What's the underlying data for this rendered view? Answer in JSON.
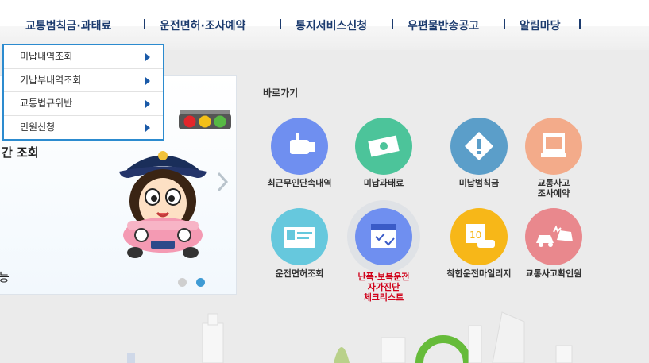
{
  "nav": {
    "items": [
      "교통범칙금·과태료",
      "운전면허·조사예약",
      "통지서비스신청",
      "우편물반송공고",
      "알림마당"
    ]
  },
  "submenu": {
    "items": [
      "미납내역조회",
      "기납부내역조회",
      "교통법규위반",
      "민원신청"
    ]
  },
  "banner": {
    "partial_text": "간 조회",
    "partial_bottom": "능"
  },
  "quick": {
    "title": "바로가기",
    "items": [
      {
        "label": "최근무인단속내역",
        "icon": "camera-icon",
        "color": "#6f8ff0"
      },
      {
        "label": "미납과태료",
        "icon": "money-icon",
        "color": "#4cc49a"
      },
      {
        "label": "미납범칙금",
        "icon": "warning-diamond-icon",
        "color": "#5b9ec9"
      },
      {
        "label": "교통사고\n조사예약",
        "icon": "monitor-icon",
        "color": "#f3ab8a"
      },
      {
        "label": "운전면허조회",
        "icon": "license-card-icon",
        "color": "#66c8dd"
      },
      {
        "label": "난폭·보복운전\n자가진단\n체크리스트",
        "icon": "calendar-check-icon",
        "color": "#6f8ff0"
      },
      {
        "label": "착한운전마일리지",
        "icon": "mileage-icon",
        "color": "#f7b718"
      },
      {
        "label": "교통사고확인원",
        "icon": "car-crash-icon",
        "color": "#e9888d"
      }
    ]
  }
}
